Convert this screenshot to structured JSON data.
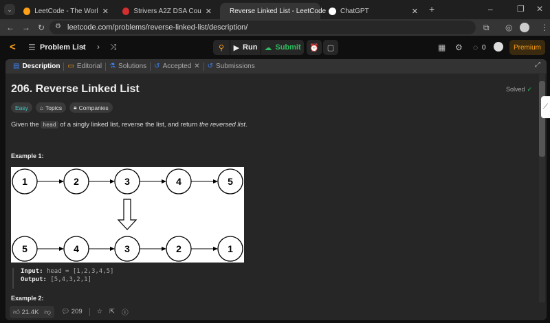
{
  "browser": {
    "tabs": [
      {
        "title": "LeetCode - The World's Leading",
        "active": false
      },
      {
        "title": "Strivers A2Z DSA Course/Sheet",
        "active": false
      },
      {
        "title": "Reverse Linked List - LeetCode",
        "active": true
      },
      {
        "title": "ChatGPT",
        "active": false
      }
    ],
    "url": "leetcode.com/problems/reverse-linked-list/description/"
  },
  "header": {
    "problem_list": "Problem List",
    "run": "Run",
    "submit": "Submit",
    "streak": "0",
    "premium": "Premium"
  },
  "panel_tabs": [
    "Description",
    "Editorial",
    "Solutions",
    "Accepted",
    "Submissions"
  ],
  "problem": {
    "title": "206. Reverse Linked List",
    "status": "Solved",
    "difficulty": "Easy",
    "topics": "Topics",
    "companies": "Companies",
    "desc_pre": "Given the ",
    "desc_code": "head",
    "desc_mid": " of a singly linked list, reverse the list, and return ",
    "desc_em": "the reversed list",
    "desc_post": ".",
    "example1": "Example 1:",
    "input_label": "Input:",
    "input_value": "head = [1,2,3,4,5]",
    "output_label": "Output:",
    "output_value": "[5,4,3,2,1]",
    "example2": "Example 2:",
    "diagram": {
      "top": [
        "1",
        "2",
        "3",
        "4",
        "5"
      ],
      "bottom": [
        "5",
        "4",
        "3",
        "2",
        "1"
      ]
    }
  },
  "footer": {
    "likes": "21.4K",
    "comments": "209"
  },
  "colors": {
    "easy": "#46c6c2",
    "solved": "#2cbb5d",
    "submit": "#2cbb5d",
    "premium": "#ffa116"
  }
}
